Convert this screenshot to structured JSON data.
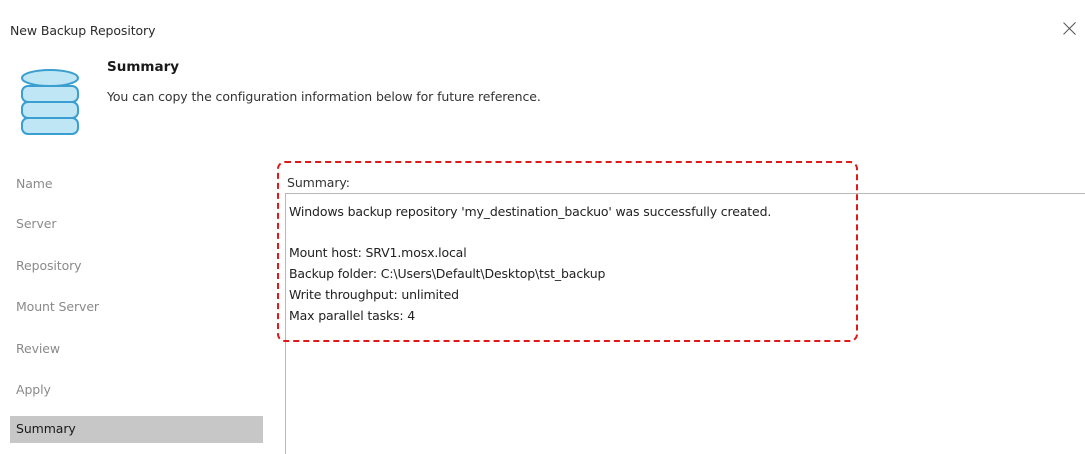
{
  "window": {
    "title": "New Backup Repository",
    "close_icon": "close-icon"
  },
  "header": {
    "icon": "database-icon",
    "title": "Summary",
    "description": "You can copy the configuration information below for future reference."
  },
  "nav": {
    "items": [
      {
        "label": "Name",
        "active": false
      },
      {
        "label": "Server",
        "active": false
      },
      {
        "label": "Repository",
        "active": false
      },
      {
        "label": "Mount Server",
        "active": false
      },
      {
        "label": "Review",
        "active": false
      },
      {
        "label": "Apply",
        "active": false
      },
      {
        "label": "Summary",
        "active": true
      }
    ]
  },
  "summary": {
    "label": "Summary:",
    "lines": [
      "Windows backup repository 'my_destination_backuo' was successfully created.",
      "Mount host: SRV1.mosx.local",
      "Backup folder: C:\\Users\\Default\\Desktop\\tst_backup",
      "Write throughput: unlimited",
      "Max parallel tasks: 4"
    ]
  },
  "colors": {
    "highlight": "#e01818",
    "nav_active_bg": "#c7c7c7",
    "icon_fill": "#bfe6f5",
    "icon_stroke": "#3a9fd0"
  }
}
